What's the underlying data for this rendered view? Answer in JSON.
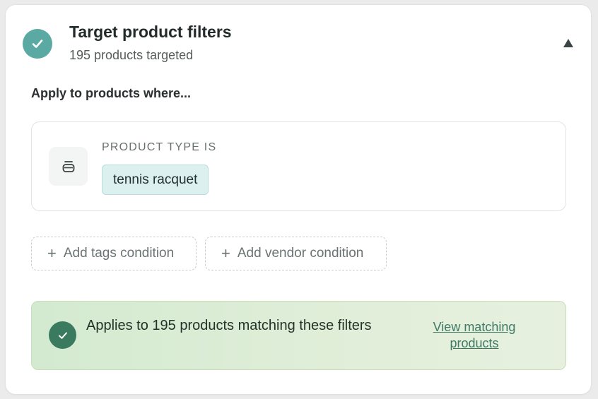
{
  "header": {
    "title": "Target product filters",
    "subtitle": "195 products targeted",
    "status_icon": "check-icon",
    "collapse_icon": "triangle-up-icon"
  },
  "filters": {
    "section_label": "Apply to products where...",
    "condition": {
      "icon": "product-type-icon",
      "label": "PRODUCT TYPE IS",
      "value": "tennis racquet"
    },
    "add_buttons": {
      "tags": "Add tags condition",
      "vendor": "Add vendor condition",
      "icon": "plus-icon"
    }
  },
  "banner": {
    "icon": "check-icon",
    "text": "Applies to 195 products matching these filters",
    "link": "View matching products"
  },
  "colors": {
    "accent_teal": "#5aa9a3",
    "success_green": "#3a7a5f",
    "chip_bg": "#dcf0f0",
    "banner_bg": "#d3ead0"
  }
}
